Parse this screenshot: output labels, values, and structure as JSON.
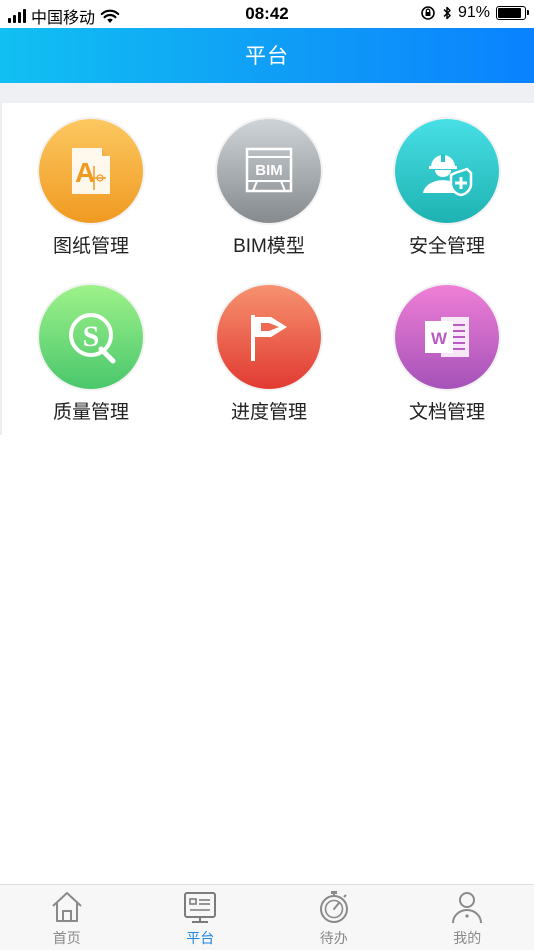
{
  "status_bar": {
    "carrier": "中国移动",
    "time": "08:42",
    "battery_percent_text": "91%",
    "battery_level": 0.91,
    "icons": [
      "signal-icon",
      "wifi-icon",
      "orientation-lock-icon",
      "bluetooth-icon",
      "battery-icon"
    ]
  },
  "header": {
    "title": "平台",
    "gradient": [
      "#11c0f2",
      "#0a82ff"
    ]
  },
  "modules": [
    {
      "label": "图纸管理",
      "icon": "drawing-icon",
      "color": "#f5a632"
    },
    {
      "label": "BIM模型",
      "icon": "bim-icon",
      "icon_text": "BIM",
      "color": "#9ea3a8"
    },
    {
      "label": "安全管理",
      "icon": "safety-worker-icon",
      "color": "#2cc5c6"
    },
    {
      "label": "质量管理",
      "icon": "quality-icon",
      "icon_text": "S",
      "color": "#6cd47a"
    },
    {
      "label": "进度管理",
      "icon": "flag-icon",
      "color": "#ea5a46"
    },
    {
      "label": "文档管理",
      "icon": "word-document-icon",
      "icon_text": "W",
      "color": "#c766c8"
    }
  ],
  "tabbar": {
    "active_color": "#1a86e8",
    "tabs": [
      {
        "label": "首页",
        "icon": "home-icon",
        "active": false
      },
      {
        "label": "平台",
        "icon": "platform-icon",
        "active": true
      },
      {
        "label": "待办",
        "icon": "stopwatch-icon",
        "active": false
      },
      {
        "label": "我的",
        "icon": "user-icon",
        "active": false
      }
    ]
  }
}
